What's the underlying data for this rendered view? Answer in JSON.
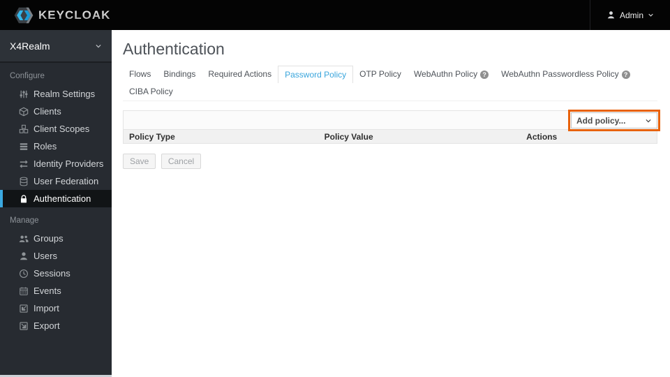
{
  "topbar": {
    "brand": "KEYCLOAK",
    "user": {
      "label": "Admin",
      "icon": "user-icon",
      "chevron": "chevron-down-icon"
    }
  },
  "sidebar": {
    "realm": {
      "label": "X4Realm",
      "icon": "chevron-down-icon"
    },
    "sections": [
      {
        "label": "Configure",
        "items": [
          {
            "label": "Realm Settings",
            "icon": "sliders-icon",
            "selected": false
          },
          {
            "label": "Clients",
            "icon": "cube-icon",
            "selected": false
          },
          {
            "label": "Client Scopes",
            "icon": "cubes-icon",
            "selected": false
          },
          {
            "label": "Roles",
            "icon": "list-icon",
            "selected": false
          },
          {
            "label": "Identity Providers",
            "icon": "exchange-icon",
            "selected": false
          },
          {
            "label": "User Federation",
            "icon": "database-icon",
            "selected": false
          },
          {
            "label": "Authentication",
            "icon": "lock-icon",
            "selected": true
          }
        ]
      },
      {
        "label": "Manage",
        "items": [
          {
            "label": "Groups",
            "icon": "users-icon",
            "selected": false
          },
          {
            "label": "Users",
            "icon": "user-icon",
            "selected": false
          },
          {
            "label": "Sessions",
            "icon": "clock-icon",
            "selected": false
          },
          {
            "label": "Events",
            "icon": "calendar-icon",
            "selected": false
          },
          {
            "label": "Import",
            "icon": "import-icon",
            "selected": false
          },
          {
            "label": "Export",
            "icon": "export-icon",
            "selected": false
          }
        ]
      }
    ]
  },
  "main": {
    "title": "Authentication",
    "tabs": [
      {
        "label": "Flows",
        "active": false,
        "help": false
      },
      {
        "label": "Bindings",
        "active": false,
        "help": false
      },
      {
        "label": "Required Actions",
        "active": false,
        "help": false
      },
      {
        "label": "Password Policy",
        "active": true,
        "help": false
      },
      {
        "label": "OTP Policy",
        "active": false,
        "help": false
      },
      {
        "label": "WebAuthn Policy",
        "active": false,
        "help": true
      },
      {
        "label": "WebAuthn Passwordless Policy",
        "active": false,
        "help": true
      },
      {
        "label": "CIBA Policy",
        "active": false,
        "help": false
      }
    ],
    "policy_table": {
      "add_policy_label": "Add policy...",
      "columns": [
        "Policy Type",
        "Policy Value",
        "Actions"
      ],
      "rows": []
    },
    "buttons": {
      "save": "Save",
      "cancel": "Cancel"
    }
  },
  "colors": {
    "accent_blue": "#39a5dc",
    "highlight_orange": "#e8620c",
    "sidebar_bg": "#272b31",
    "topbar_bg": "#040404"
  }
}
